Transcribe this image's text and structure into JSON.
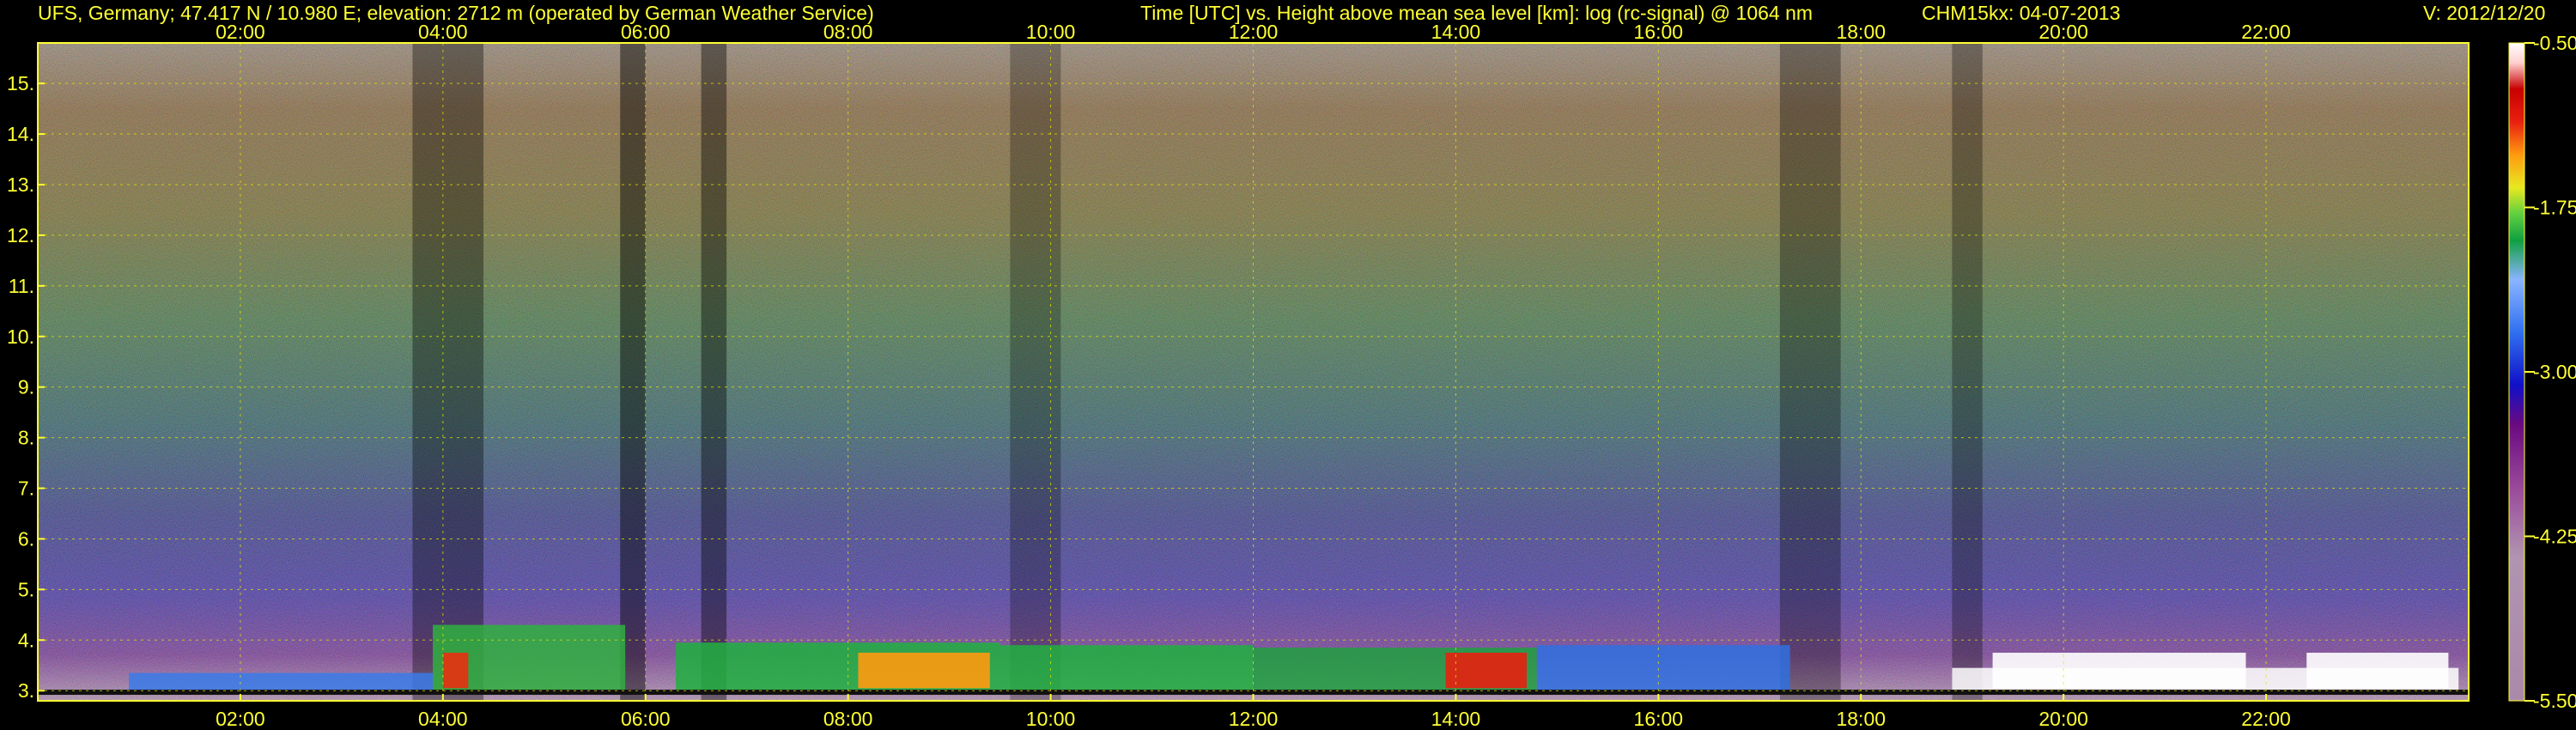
{
  "header": {
    "station": "UFS, Germany; 47.417 N / 10.980 E; elevation: 2712 m  (operated by German Weather Service)",
    "description": "Time [UTC] vs. Height above mean sea level [km]: log (rc-signal) @ 1064 nm",
    "instrument_date": "CHM15kx: 04-07-2013",
    "version": "V: 2012/12/20"
  },
  "colors": {
    "text": "#ffff33",
    "grid": "#e6e600",
    "background": "#000000"
  },
  "chart_data": {
    "type": "heatmap",
    "x_ticks": [
      "02:00",
      "04:00",
      "06:00",
      "08:00",
      "10:00",
      "12:00",
      "14:00",
      "16:00",
      "18:00",
      "20:00",
      "22:00"
    ],
    "x_tick_hours": [
      2,
      4,
      6,
      8,
      10,
      12,
      14,
      16,
      18,
      20,
      22
    ],
    "xlim": [
      0,
      24
    ],
    "y_ticks": [
      "3.",
      "4.",
      "5.",
      "6.",
      "7.",
      "8.",
      "9.",
      "10.",
      "11.",
      "12.",
      "13.",
      "14.",
      "15."
    ],
    "y_tick_values": [
      3,
      4,
      5,
      6,
      7,
      8,
      9,
      10,
      11,
      12,
      13,
      14,
      15
    ],
    "ylim": [
      2.8,
      15.8
    ],
    "grid": true,
    "colorbar": {
      "ticks": [
        "-0.50",
        "-1.75",
        "-3.00",
        "-4.25",
        "-5.50"
      ],
      "tick_values": [
        -0.5,
        -1.75,
        -3.0,
        -4.25,
        -5.5
      ],
      "range": [
        -5.5,
        -0.5
      ]
    }
  }
}
